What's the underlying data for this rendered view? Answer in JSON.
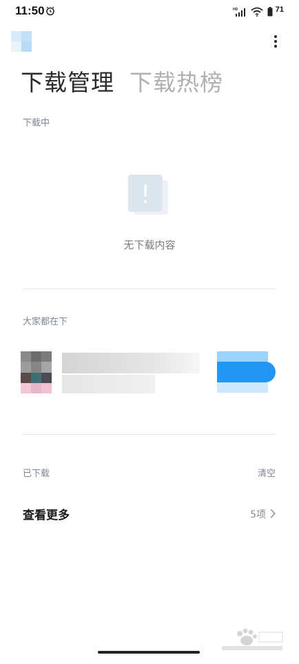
{
  "status_bar": {
    "time": "11:50",
    "battery": "71",
    "icons": [
      "alarm-icon",
      "hd-signal-icon",
      "wifi-icon",
      "battery-icon"
    ]
  },
  "header": {
    "tabs": [
      {
        "label": "下载管理",
        "active": true
      },
      {
        "label": "下载热榜",
        "active": false
      }
    ]
  },
  "downloading": {
    "section_label": "下载中",
    "empty_text": "无下载内容"
  },
  "popular": {
    "section_label": "大家都在下"
  },
  "downloaded": {
    "section_label": "已下载",
    "clear_label": "清空",
    "row_title": "查看更多",
    "row_count": "5项"
  },
  "colors": {
    "accent": "#2196f3",
    "section_label": "#7d8696",
    "tab_inactive": "#b0b0b0"
  }
}
